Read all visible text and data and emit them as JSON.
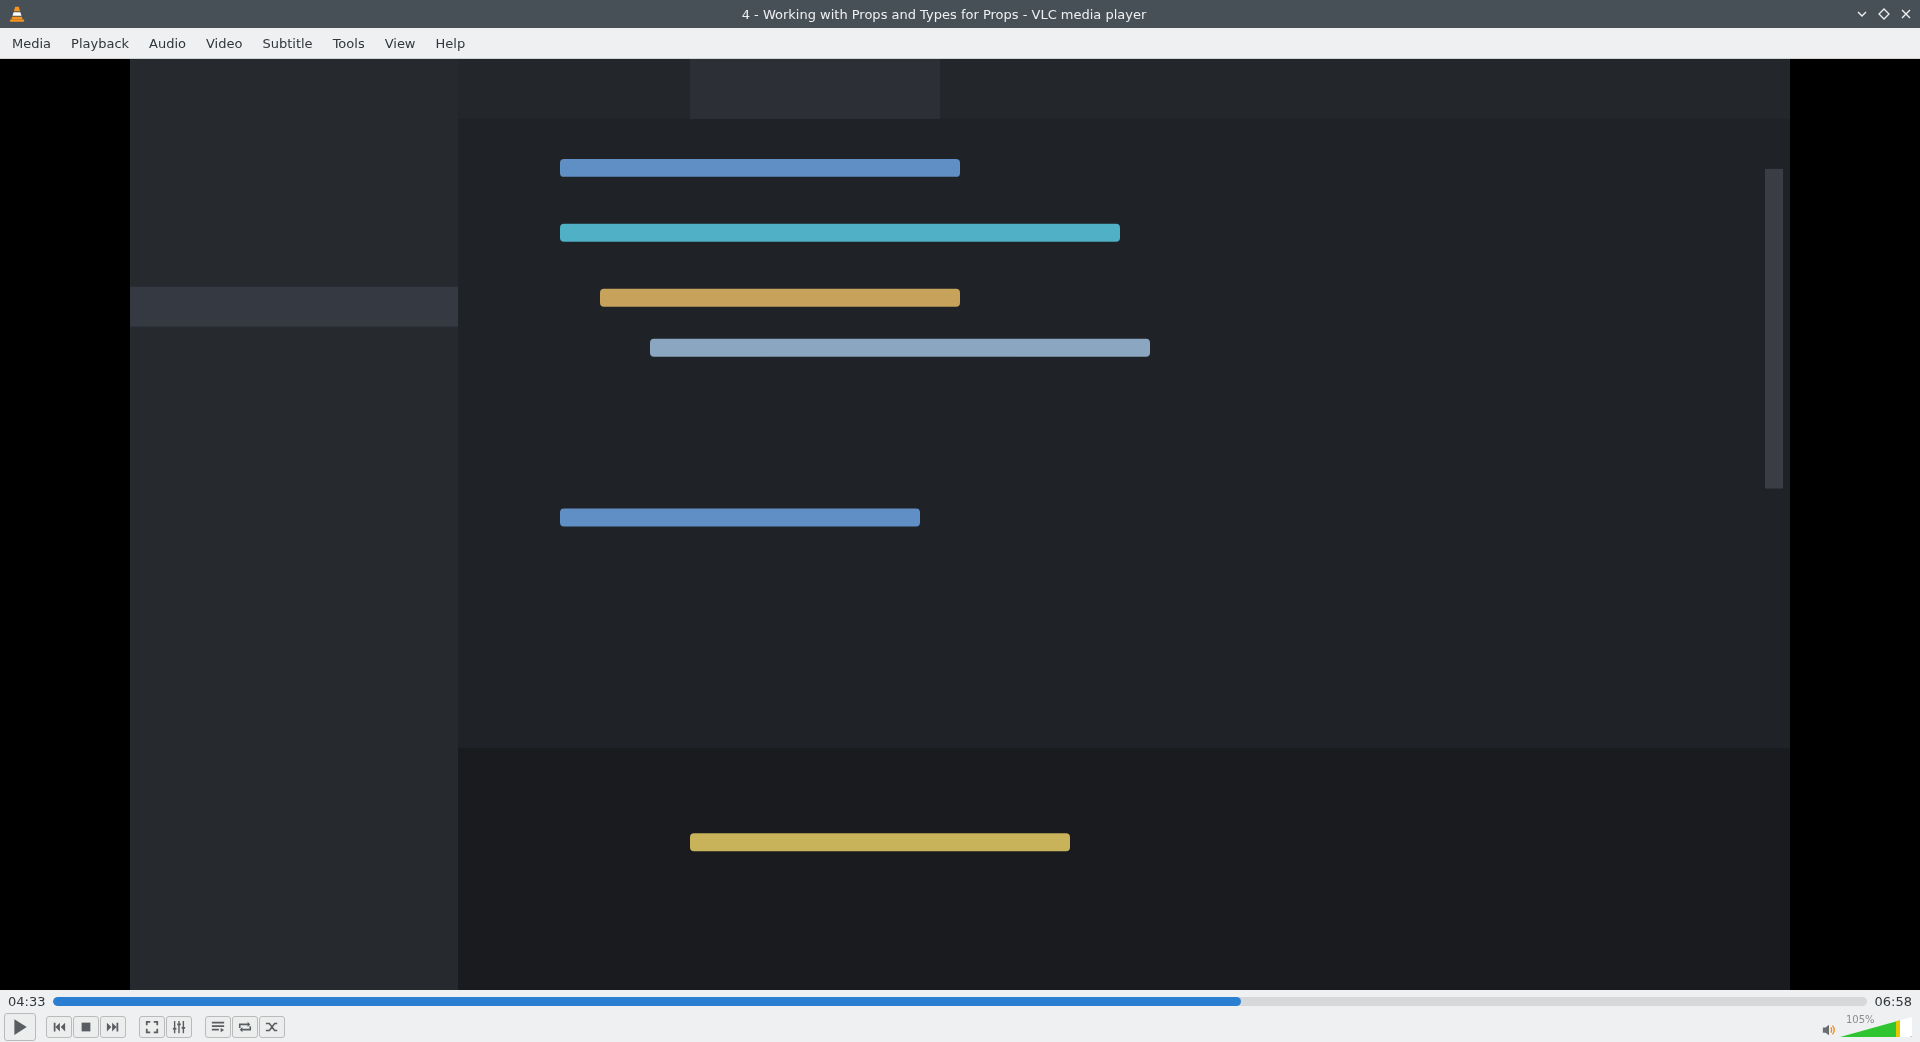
{
  "window": {
    "title": "4 - Working with Props and Types for Props - VLC media player"
  },
  "menu": [
    "Media",
    "Playback",
    "Audio",
    "Video",
    "Subtitle",
    "Tools",
    "View",
    "Help"
  ],
  "seek": {
    "elapsed": "04:33",
    "total": "06:58",
    "level": 0.655
  },
  "volume": {
    "reading": "105%",
    "level": 0.84
  }
}
